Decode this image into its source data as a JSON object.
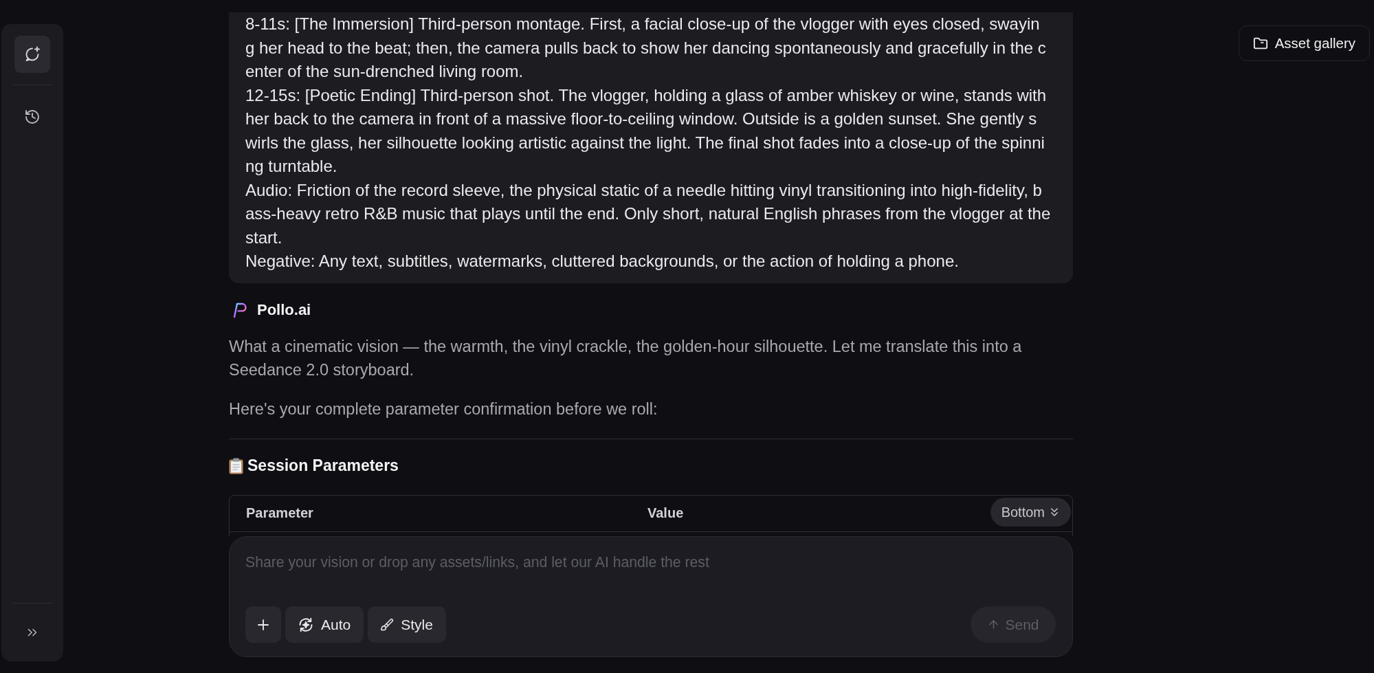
{
  "sidebar": {
    "items": [
      {
        "kind": "new-chat",
        "selected": true
      },
      {
        "kind": "history",
        "selected": false
      }
    ]
  },
  "toolbar": {
    "asset_gallery": "Asset gallery"
  },
  "prompt_bubble": {
    "paragraphs": [
      [
        "8-11s: [The Immersion] Third-person montage. First, a facial close-up of the vlogger with eyes closed, swayin",
        "g her head to the beat; then, the camera pulls back to show her dancing spontaneously and gracefully in the c",
        "enter of the sun-drenched living room."
      ],
      [
        "12-15s: [Poetic Ending] Third-person shot. The vlogger, holding a glass of amber whiskey or wine, stands with",
        "her back to the camera in front of a massive floor-to-ceiling window. Outside is a golden sunset. She gently s",
        "wirls the glass, her silhouette looking artistic against the light. The final shot fades into a close-up of the spinni",
        "ng turntable."
      ],
      [
        "Audio: Friction of the record sleeve, the physical static of a needle hitting vinyl transitioning into high-fidelity, b",
        "ass-heavy retro R&B music that plays until the end. Only short, natural English phrases from the vlogger at the",
        "start."
      ],
      [
        "Negative: Any text, subtitles, watermarks, cluttered backgrounds, or the action of holding a phone."
      ]
    ]
  },
  "assistant": {
    "name": "Pollo.ai",
    "paragraphs": [
      "What a cinematic vision — the warmth, the vinyl crackle, the golden-hour silhouette. Let me translate this into a Seedance 2.0 storyboard.",
      "Here's your complete parameter confirmation before we roll:"
    ],
    "section_title": "Session Parameters",
    "table": {
      "columns": [
        "Parameter",
        "Value"
      ]
    }
  },
  "scroll_button": {
    "label": "Bottom"
  },
  "composer": {
    "placeholder": "Share your vision or drop any assets/links, and let our AI handle the rest",
    "tools": [
      {
        "kind": "add"
      },
      {
        "kind": "auto",
        "label": "Auto"
      },
      {
        "kind": "style",
        "label": "Style"
      }
    ],
    "send": {
      "label": "Send",
      "disabled": true
    }
  }
}
